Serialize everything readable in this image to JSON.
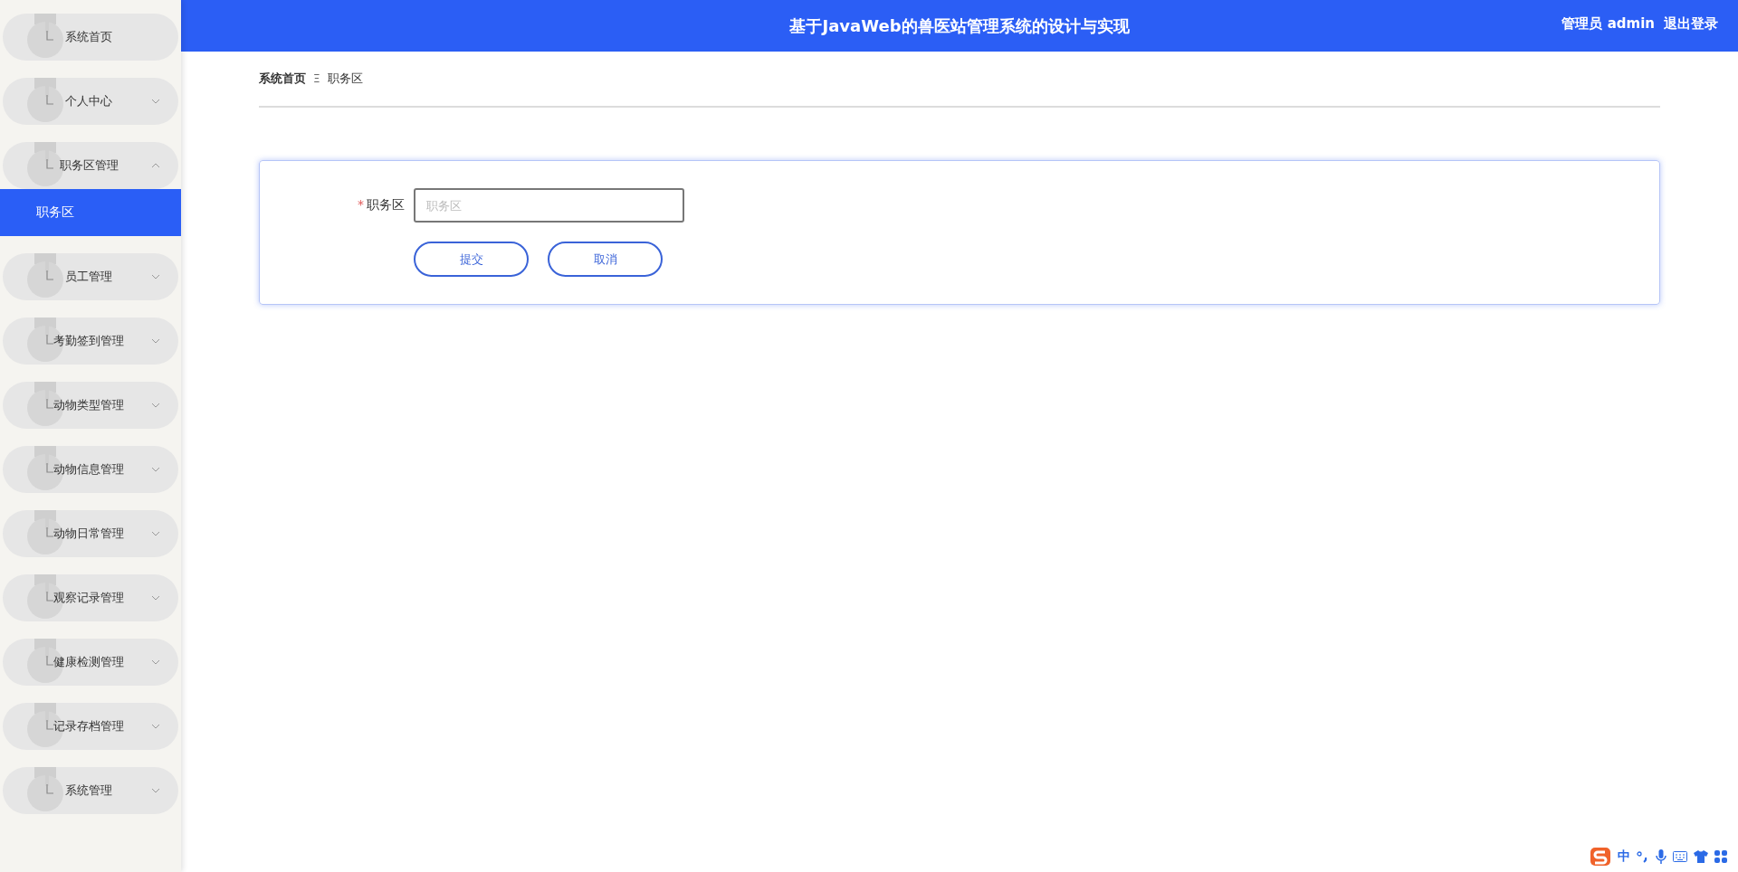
{
  "header": {
    "title": "基于JavaWeb的兽医站管理系统的设计与实现",
    "user": "管理员 admin",
    "logout": "退出登录"
  },
  "sidebar": {
    "items": [
      {
        "label": "系统首页",
        "kind": "link"
      },
      {
        "label": "个人中心",
        "kind": "group",
        "expanded": false
      },
      {
        "label": "职务区管理",
        "kind": "group",
        "expanded": true,
        "children": [
          {
            "label": "职务区",
            "selected": true
          }
        ]
      },
      {
        "label": "员工管理",
        "kind": "group",
        "expanded": false
      },
      {
        "label": "考勤签到管理",
        "kind": "group",
        "expanded": false
      },
      {
        "label": "动物类型管理",
        "kind": "group",
        "expanded": false
      },
      {
        "label": "动物信息管理",
        "kind": "group",
        "expanded": false
      },
      {
        "label": "动物日常管理",
        "kind": "group",
        "expanded": false
      },
      {
        "label": "观察记录管理",
        "kind": "group",
        "expanded": false
      },
      {
        "label": "健康检测管理",
        "kind": "group",
        "expanded": false
      },
      {
        "label": "记录存档管理",
        "kind": "group",
        "expanded": false
      },
      {
        "label": "系统管理",
        "kind": "group",
        "expanded": false
      }
    ]
  },
  "breadcrumb": [
    {
      "label": "系统首页"
    },
    {
      "label": "职务区"
    }
  ],
  "breadcrumb_separator": "Ξ",
  "form": {
    "fields": [
      {
        "label": "职务区",
        "required_mark": "*",
        "placeholder": "职务区"
      }
    ],
    "buttons": [
      "提交",
      "取消"
    ]
  },
  "ime_bar": {
    "mode": "中"
  }
}
